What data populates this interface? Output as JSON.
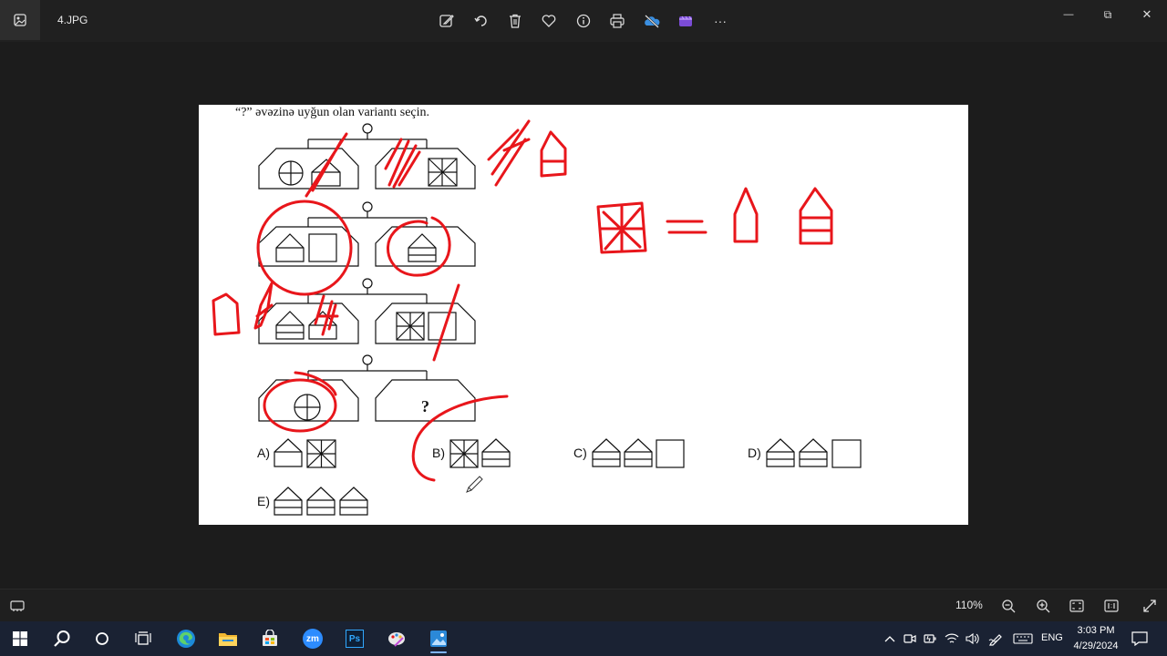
{
  "app": {
    "file_name": "4.JPG",
    "app_icon": "photos-icon"
  },
  "toolbar": {
    "buttons": [
      "edit-icon",
      "rotate-icon",
      "delete-icon",
      "favorite-icon",
      "info-icon",
      "print-icon",
      "onedrive-icon",
      "clipchamp-icon",
      "more-icon"
    ],
    "more_label": "···"
  },
  "window": {
    "minimize": "—",
    "maximize": "⧉",
    "close": "✕"
  },
  "image": {
    "question": "“?” əvəzinə uyğun olan variantı seçin.",
    "mystery_mark": "?",
    "answers": [
      {
        "label": "A)"
      },
      {
        "label": "B)"
      },
      {
        "label": "C)"
      },
      {
        "label": "D)"
      },
      {
        "label": "E)"
      }
    ],
    "annotation_color": "#e8161b"
  },
  "statusbar": {
    "zoom": "110%",
    "buttons": [
      "filmstrip-icon",
      "zoom-out-icon",
      "zoom-in-icon",
      "fit-to-window-icon",
      "actual-size-icon",
      "fullscreen-icon"
    ]
  },
  "taskbar": {
    "apps": [
      "windows-start-icon",
      "search-icon",
      "cortana-icon",
      "task-view-icon",
      "edge-icon",
      "file-explorer-icon",
      "store-icon",
      "zoom-icon",
      "photoshop-icon",
      "paint-icon",
      "photos-icon"
    ],
    "zoom_app_text": "zm",
    "ps_text": "Ps",
    "language": "ENG",
    "time": "3:03 PM",
    "date": "4/29/2024"
  }
}
